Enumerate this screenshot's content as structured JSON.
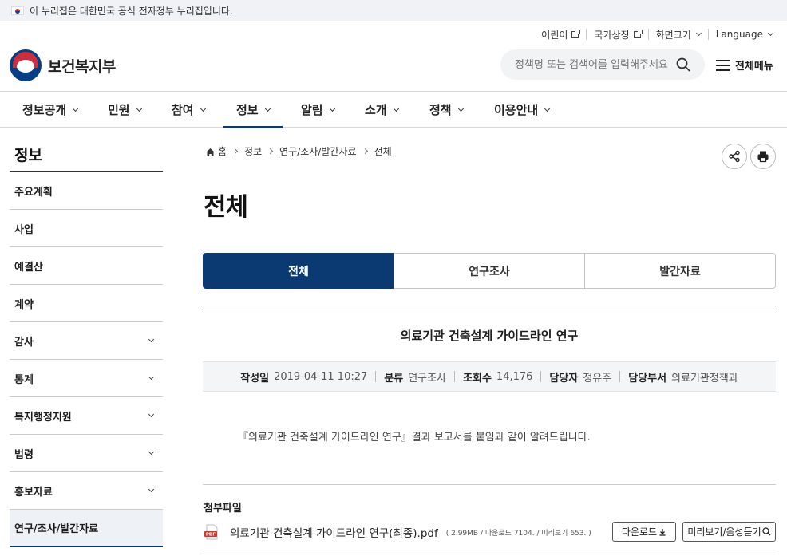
{
  "gov_banner": {
    "text": "이 누리집은 대한민국 공식 전자정부 누리집입니다."
  },
  "util_links": [
    {
      "label": "어린이"
    },
    {
      "label": "국가상징"
    },
    {
      "label": "화면크기"
    },
    {
      "label": "Language"
    }
  ],
  "logo": {
    "text": "보건복지부"
  },
  "search": {
    "placeholder": "정책명 또는 검색어를 입력해주세요",
    "icon": "search-icon"
  },
  "all_menu": {
    "label": "전체메뉴"
  },
  "gnb": [
    {
      "label": "정보공개"
    },
    {
      "label": "민원"
    },
    {
      "label": "참여"
    },
    {
      "label": "정보",
      "active": true
    },
    {
      "label": "알림"
    },
    {
      "label": "소개"
    },
    {
      "label": "정책"
    },
    {
      "label": "이용안내"
    }
  ],
  "lnb": {
    "title": "정보",
    "items": [
      {
        "label": "주요계획",
        "has_sub": false
      },
      {
        "label": "사업",
        "has_sub": false
      },
      {
        "label": "예결산",
        "has_sub": false
      },
      {
        "label": "계약",
        "has_sub": false
      },
      {
        "label": "감사",
        "has_sub": true
      },
      {
        "label": "통계",
        "has_sub": true
      },
      {
        "label": "복지행정지원",
        "has_sub": true
      },
      {
        "label": "법령",
        "has_sub": true
      },
      {
        "label": "홍보자료",
        "has_sub": true
      },
      {
        "label": "연구/조사/발간자료",
        "has_sub": false,
        "active": true
      }
    ]
  },
  "breadcrumb": [
    "홈",
    "정보",
    "연구/조사/발간자료",
    "전체"
  ],
  "page_title": "전체",
  "tabs": [
    {
      "label": "전체",
      "active": true
    },
    {
      "label": "연구조사"
    },
    {
      "label": "발간자료"
    }
  ],
  "article": {
    "title": "의료기관 건축설계 가이드라인 연구",
    "meta": {
      "date_label": "작성일",
      "date": "2019-04-11 10:27",
      "category_label": "분류",
      "category": "연구조사",
      "views_label": "조회수",
      "views": "14,176",
      "manager_label": "담당자",
      "manager": "정유주",
      "dept_label": "담당부서",
      "dept": "의료기관정책과"
    },
    "body": "『의료기관 건축설계 가이드라인 연구』결과 보고서를 붙임과 같이 알려드립니다."
  },
  "attachments": {
    "title": "첨부파일",
    "files": [
      {
        "name": "의료기관 건축설계 가이드라인 연구(최종).pdf",
        "info": "( 2.99MB / 다운로드 7104. / 미리보기 653. )",
        "download_label": "다운로드",
        "preview_label": "미리보기/음성듣기"
      }
    ]
  },
  "colors": {
    "primary": "#0b3a72",
    "flag_red": "#cd2e3a",
    "flag_blue": "#0047a0"
  }
}
